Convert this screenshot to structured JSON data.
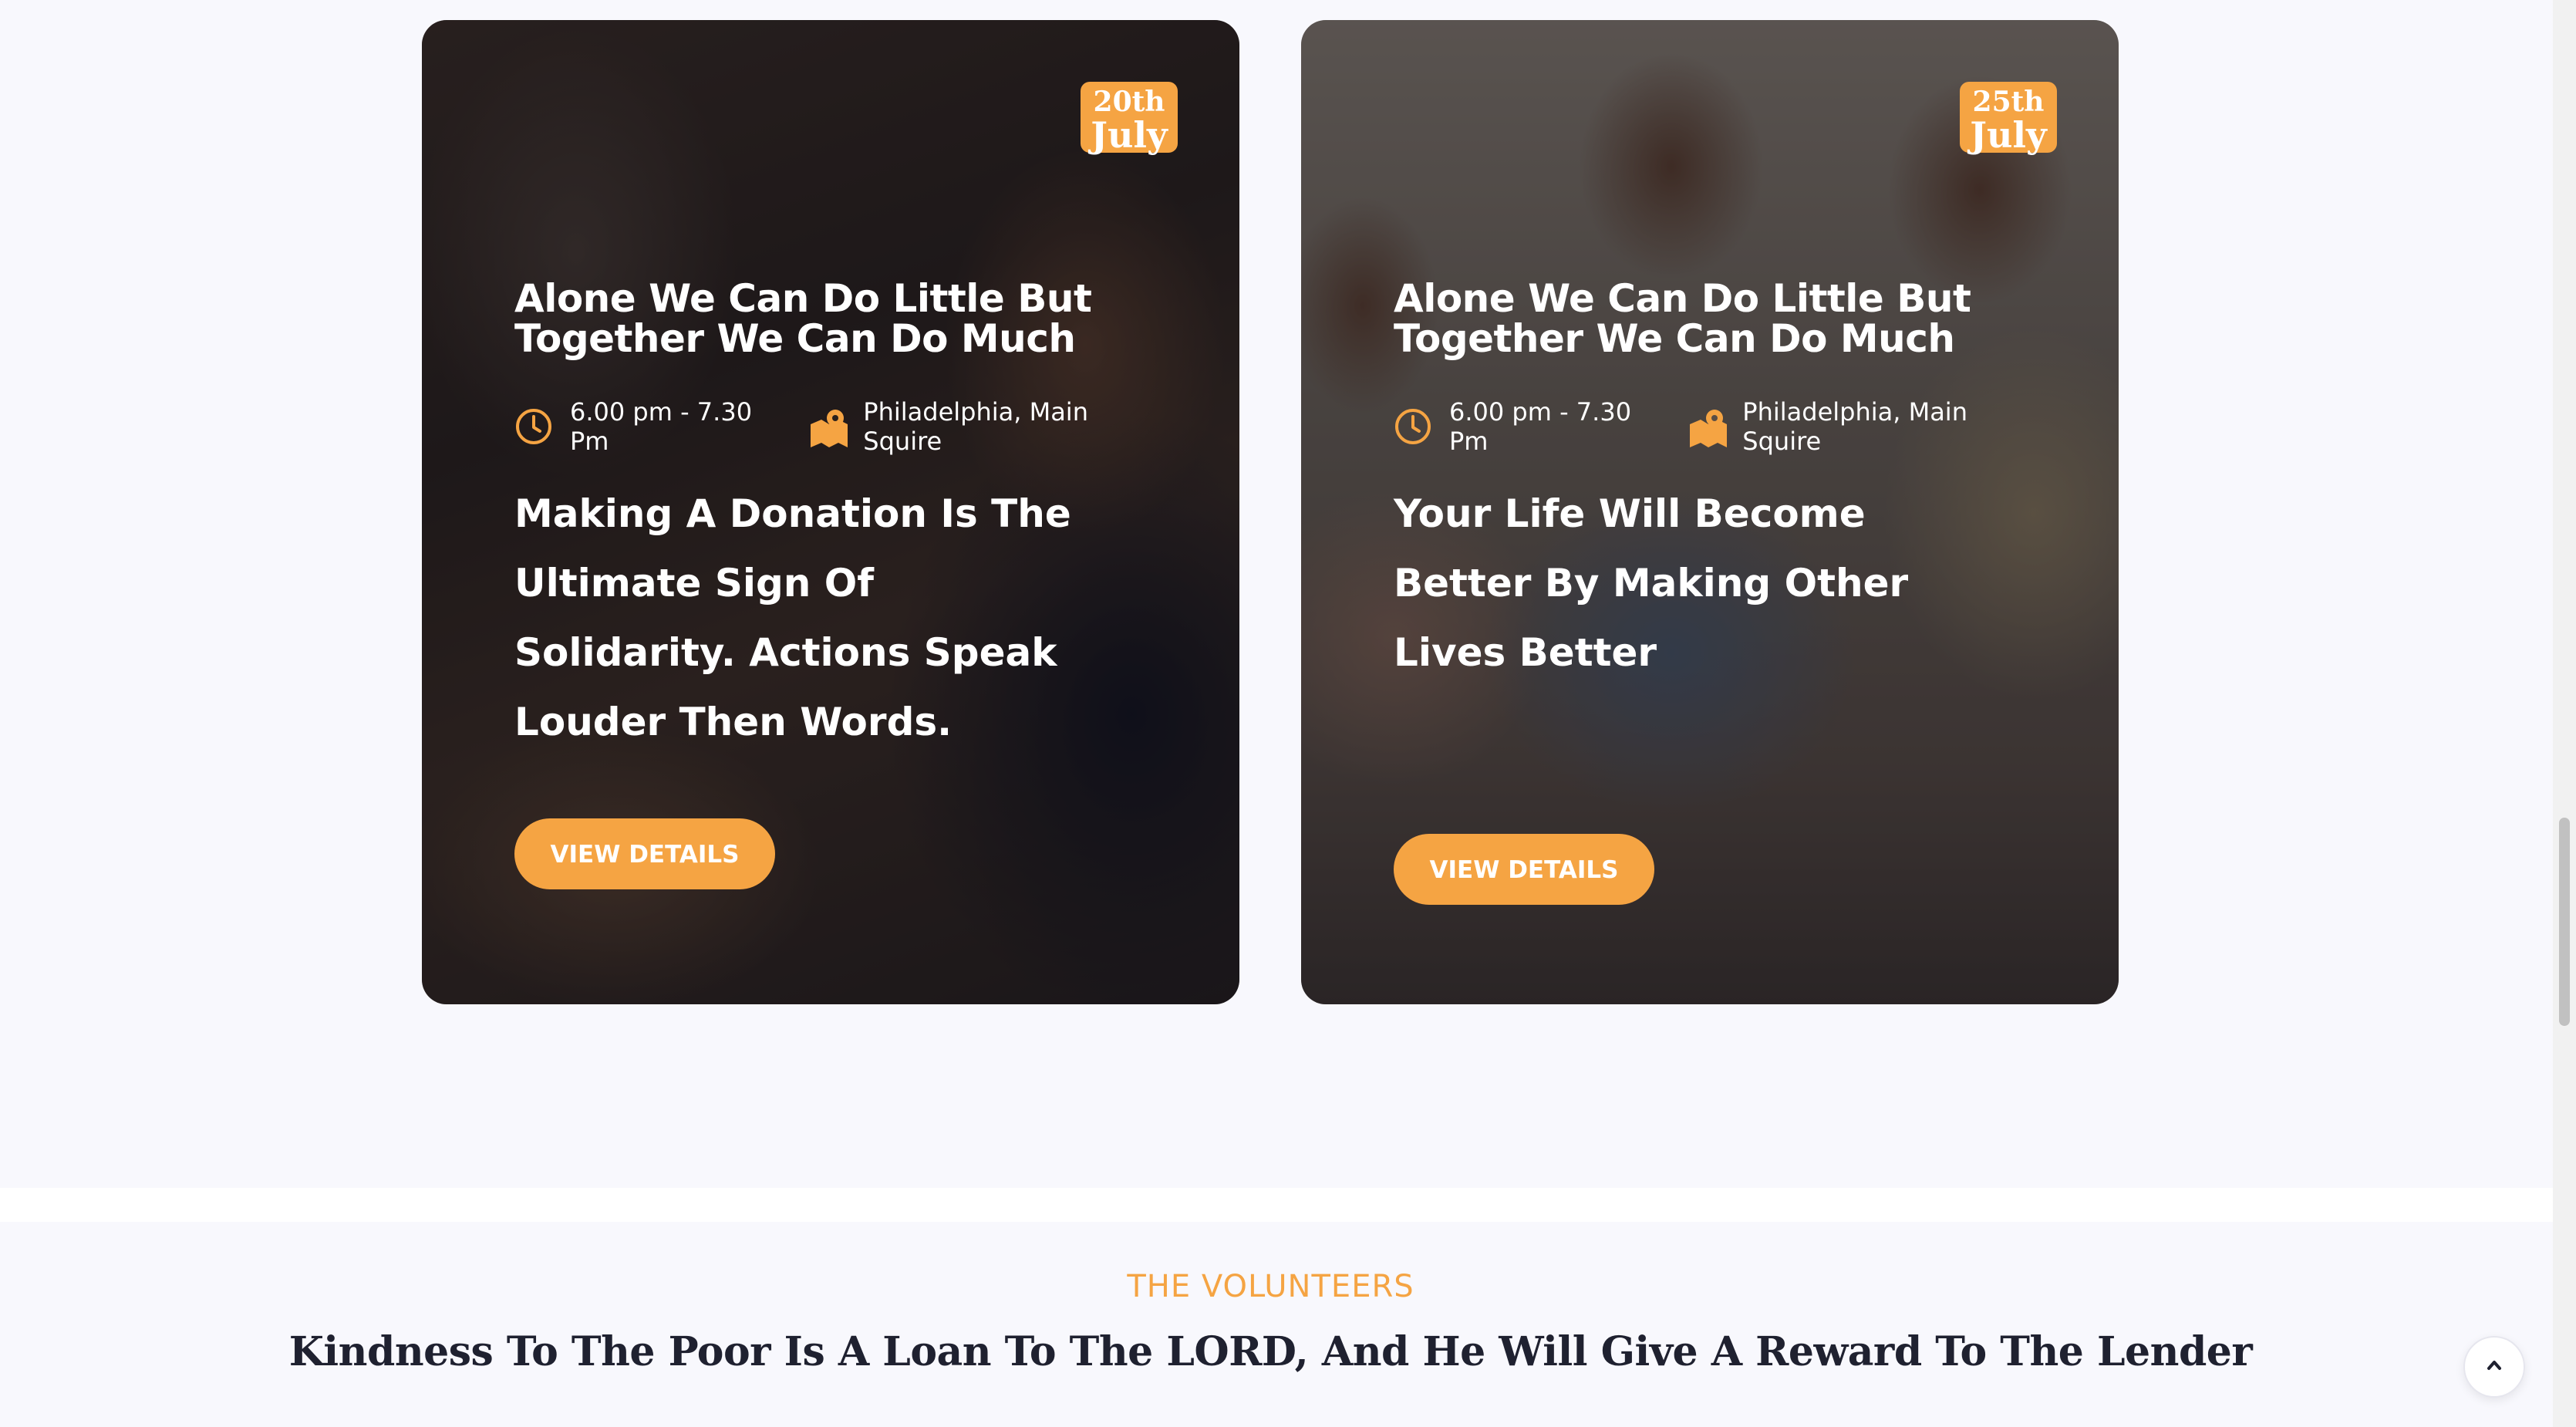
{
  "events": [
    {
      "date_day": "20th",
      "date_month": "July",
      "title_line1": "Alone We Can Do Little But",
      "title_line2": "Together We Can Do Much",
      "time": "6.00 pm - 7.30 Pm",
      "location": "Philadelphia, Main Squire",
      "description": "Making A Donation Is The Ultimate Sign Of Solidarity. Actions Speak Louder Then Words.",
      "button_label": "VIEW DETAILS"
    },
    {
      "date_day": "25th",
      "date_month": "July",
      "title_line1": "Alone We Can Do Little But",
      "title_line2": "Together We Can Do Much",
      "time": "6.00 pm - 7.30 Pm",
      "location": "Philadelphia, Main Squire",
      "description": "Your Life Will Become Better By Making Other Lives Better",
      "button_label": "VIEW DETAILS"
    }
  ],
  "volunteers": {
    "kicker": "THE VOLUNTEERS",
    "title": "Kindness To The Poor Is A Loan To The LORD, And He Will Give A Reward To The Lender"
  },
  "icons": {
    "time": "clock-icon",
    "location": "map-icon",
    "back_to_top": "chevron-up-icon"
  },
  "colors": {
    "accent": "#f5a443",
    "heading_dark": "#1f2130",
    "page_bg": "#f8f8fd"
  }
}
